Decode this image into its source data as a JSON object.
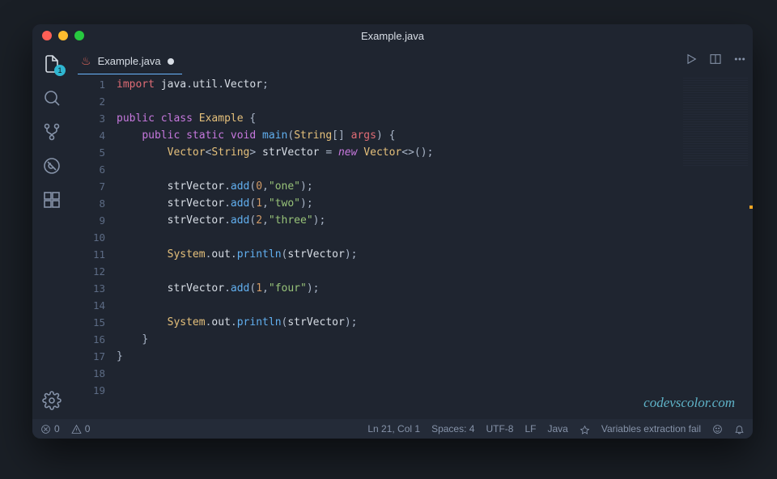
{
  "window": {
    "title": "Example.java"
  },
  "activity": {
    "explorer_badge": "1"
  },
  "tab": {
    "filename": "Example.java"
  },
  "code": {
    "lines": [
      {
        "num": 1,
        "tokens": [
          [
            "tk-keyword2",
            "import"
          ],
          [
            "sp",
            " "
          ],
          [
            "tk-var",
            "java"
          ],
          [
            "tk-punct",
            "."
          ],
          [
            "tk-var",
            "util"
          ],
          [
            "tk-punct",
            "."
          ],
          [
            "tk-var",
            "Vector"
          ],
          [
            "tk-punct",
            ";"
          ]
        ]
      },
      {
        "num": 2,
        "tokens": []
      },
      {
        "num": 3,
        "tokens": [
          [
            "tk-keyword",
            "public"
          ],
          [
            "sp",
            " "
          ],
          [
            "tk-keyword",
            "class"
          ],
          [
            "sp",
            " "
          ],
          [
            "tk-type",
            "Example"
          ],
          [
            "sp",
            " "
          ],
          [
            "tk-punct",
            "{"
          ]
        ]
      },
      {
        "num": 4,
        "tokens": [
          [
            "sp",
            "    "
          ],
          [
            "tk-keyword",
            "public"
          ],
          [
            "sp",
            " "
          ],
          [
            "tk-keyword",
            "static"
          ],
          [
            "sp",
            " "
          ],
          [
            "tk-keyword",
            "void"
          ],
          [
            "sp",
            " "
          ],
          [
            "tk-method",
            "main"
          ],
          [
            "tk-punct",
            "("
          ],
          [
            "tk-type",
            "String"
          ],
          [
            "tk-punct",
            "[] "
          ],
          [
            "tk-param",
            "args"
          ],
          [
            "tk-punct",
            ") {"
          ]
        ]
      },
      {
        "num": 5,
        "tokens": [
          [
            "sp",
            "        "
          ],
          [
            "tk-type",
            "Vector"
          ],
          [
            "tk-punct",
            "<"
          ],
          [
            "tk-type",
            "String"
          ],
          [
            "tk-punct",
            "> "
          ],
          [
            "tk-var",
            "strVector"
          ],
          [
            "sp",
            " "
          ],
          [
            "tk-punct",
            "="
          ],
          [
            "sp",
            " "
          ],
          [
            "tk-new",
            "new"
          ],
          [
            "sp",
            " "
          ],
          [
            "tk-type",
            "Vector"
          ],
          [
            "tk-punct",
            "<>();"
          ]
        ]
      },
      {
        "num": 6,
        "tokens": []
      },
      {
        "num": 7,
        "tokens": [
          [
            "sp",
            "        "
          ],
          [
            "tk-var",
            "strVector"
          ],
          [
            "tk-punct",
            "."
          ],
          [
            "tk-method",
            "add"
          ],
          [
            "tk-punct",
            "("
          ],
          [
            "tk-number",
            "0"
          ],
          [
            "tk-punct",
            ","
          ],
          [
            "tk-string",
            "\"one\""
          ],
          [
            "tk-punct",
            ");"
          ]
        ]
      },
      {
        "num": 8,
        "tokens": [
          [
            "sp",
            "        "
          ],
          [
            "tk-var",
            "strVector"
          ],
          [
            "tk-punct",
            "."
          ],
          [
            "tk-method",
            "add"
          ],
          [
            "tk-punct",
            "("
          ],
          [
            "tk-number",
            "1"
          ],
          [
            "tk-punct",
            ","
          ],
          [
            "tk-string",
            "\"two\""
          ],
          [
            "tk-punct",
            ");"
          ]
        ]
      },
      {
        "num": 9,
        "tokens": [
          [
            "sp",
            "        "
          ],
          [
            "tk-var",
            "strVector"
          ],
          [
            "tk-punct",
            "."
          ],
          [
            "tk-method",
            "add"
          ],
          [
            "tk-punct",
            "("
          ],
          [
            "tk-number",
            "2"
          ],
          [
            "tk-punct",
            ","
          ],
          [
            "tk-string",
            "\"three\""
          ],
          [
            "tk-punct",
            ");"
          ]
        ]
      },
      {
        "num": 10,
        "tokens": []
      },
      {
        "num": 11,
        "tokens": [
          [
            "sp",
            "        "
          ],
          [
            "tk-type",
            "System"
          ],
          [
            "tk-punct",
            "."
          ],
          [
            "tk-var",
            "out"
          ],
          [
            "tk-punct",
            "."
          ],
          [
            "tk-method",
            "println"
          ],
          [
            "tk-punct",
            "("
          ],
          [
            "tk-var",
            "strVector"
          ],
          [
            "tk-punct",
            ");"
          ]
        ]
      },
      {
        "num": 12,
        "tokens": []
      },
      {
        "num": 13,
        "tokens": [
          [
            "sp",
            "        "
          ],
          [
            "tk-var",
            "strVector"
          ],
          [
            "tk-punct",
            "."
          ],
          [
            "tk-method",
            "add"
          ],
          [
            "tk-punct",
            "("
          ],
          [
            "tk-number",
            "1"
          ],
          [
            "tk-punct",
            ","
          ],
          [
            "tk-string",
            "\"four\""
          ],
          [
            "tk-punct",
            ");"
          ]
        ]
      },
      {
        "num": 14,
        "tokens": []
      },
      {
        "num": 15,
        "tokens": [
          [
            "sp",
            "        "
          ],
          [
            "tk-type",
            "System"
          ],
          [
            "tk-punct",
            "."
          ],
          [
            "tk-var",
            "out"
          ],
          [
            "tk-punct",
            "."
          ],
          [
            "tk-method",
            "println"
          ],
          [
            "tk-punct",
            "("
          ],
          [
            "tk-var",
            "strVector"
          ],
          [
            "tk-punct",
            ");"
          ]
        ]
      },
      {
        "num": 16,
        "tokens": [
          [
            "sp",
            "    "
          ],
          [
            "tk-punct",
            "}"
          ]
        ]
      },
      {
        "num": 17,
        "tokens": [
          [
            "tk-punct",
            "}"
          ]
        ]
      },
      {
        "num": 18,
        "tokens": []
      },
      {
        "num": 19,
        "tokens": []
      }
    ]
  },
  "watermark": "codevscolor.com",
  "status": {
    "errors": "0",
    "warnings": "0",
    "cursor": "Ln 21, Col 1",
    "spaces": "Spaces: 4",
    "encoding": "UTF-8",
    "eol": "LF",
    "language": "Java",
    "message": "Variables extraction fail"
  }
}
